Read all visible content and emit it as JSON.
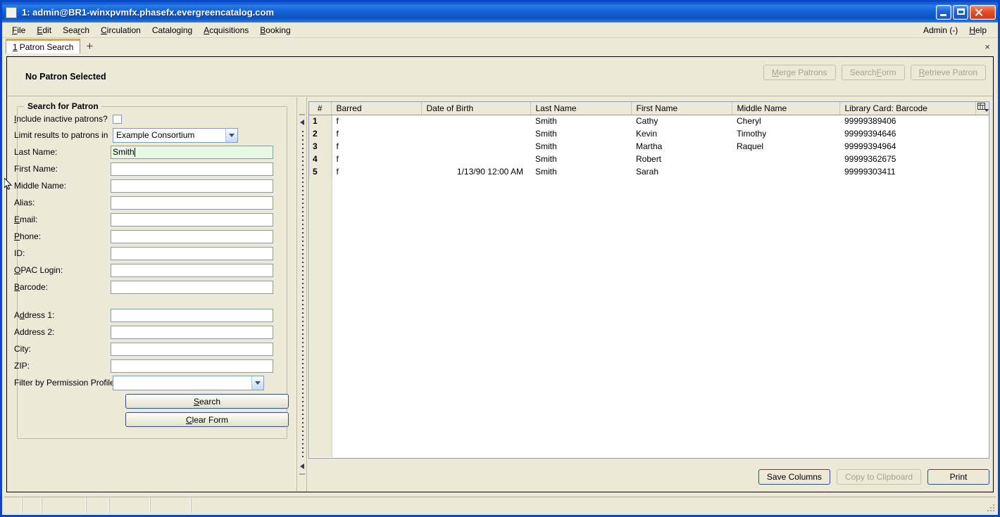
{
  "window": {
    "title": "1: admin@BR1-winxpvmfx.phasefx.evergreencatalog.com",
    "icon": "app-window-icon",
    "minimize_label": "Minimize",
    "maximize_label": "Maximize",
    "close_label": "Close"
  },
  "menubar": {
    "items": [
      {
        "label": "File",
        "accel": "F"
      },
      {
        "label": "Edit",
        "accel": "E"
      },
      {
        "label": "Search",
        "accel": "r"
      },
      {
        "label": "Circulation",
        "accel": "C"
      },
      {
        "label": "Cataloging",
        "accel": "g"
      },
      {
        "label": "Acquisitions",
        "accel": "A"
      },
      {
        "label": "Booking",
        "accel": "B"
      }
    ],
    "right": [
      {
        "label": "Admin (-)",
        "accel": ""
      },
      {
        "label": "Help",
        "accel": "H"
      }
    ]
  },
  "tabs": {
    "items": [
      {
        "number": "1",
        "label": "Patron Search"
      }
    ],
    "new_tab_label": "+",
    "close_label": "×"
  },
  "patron_header": {
    "status": "No Patron Selected",
    "buttons": [
      {
        "label": "Merge Patrons",
        "accel": "M",
        "disabled": true
      },
      {
        "label": "Search Form",
        "accel": "F",
        "disabled": true
      },
      {
        "label": "Retrieve Patron",
        "accel": "R",
        "disabled": true
      }
    ]
  },
  "search_form": {
    "legend": "Search for Patron",
    "include_inactive": {
      "label": "Include inactive patrons?",
      "accel": "I",
      "checked": false
    },
    "limit_results": {
      "label": "Limit results to patrons in",
      "value": "Example Consortium"
    },
    "fields": [
      {
        "label": "Last Name:",
        "accel": "",
        "value": "Smith",
        "focused": true
      },
      {
        "label": "First Name:",
        "accel": "",
        "value": ""
      },
      {
        "label": "Middle Name:",
        "accel": "",
        "value": ""
      },
      {
        "label": "Alias:",
        "accel": "",
        "value": ""
      },
      {
        "label": "Email:",
        "accel": "E",
        "value": ""
      },
      {
        "label": "Phone:",
        "accel": "P",
        "value": ""
      },
      {
        "label": "ID:",
        "accel": "",
        "value": ""
      },
      {
        "label": "OPAC Login:",
        "accel": "O",
        "value": ""
      },
      {
        "label": "Barcode:",
        "accel": "B",
        "value": ""
      }
    ],
    "address_fields": [
      {
        "label": "Address 1:",
        "accel": "d",
        "value": ""
      },
      {
        "label": "Address 2:",
        "accel": "",
        "value": ""
      },
      {
        "label": "City:",
        "accel": "",
        "value": ""
      },
      {
        "label": "ZIP:",
        "accel": "",
        "value": ""
      }
    ],
    "permission_profile": {
      "label": "Filter by Permission Profile:",
      "value": ""
    },
    "search_button": {
      "label": "Search",
      "accel": "S"
    },
    "clear_button": {
      "label": "Clear Form",
      "accel": "C"
    }
  },
  "results": {
    "columns": [
      "#",
      "Barred",
      "Date of Birth",
      "Last Name",
      "First Name",
      "Middle Name",
      "Library Card: Barcode"
    ],
    "column_picker_icon": "column-picker-icon",
    "rows": [
      {
        "num": "1",
        "barred": "f",
        "dob": "",
        "last": "Smith",
        "first": "Cathy",
        "middle": "Cheryl",
        "barcode": "99999389406"
      },
      {
        "num": "2",
        "barred": "f",
        "dob": "",
        "last": "Smith",
        "first": "Kevin",
        "middle": "Timothy",
        "barcode": "99999394646"
      },
      {
        "num": "3",
        "barred": "f",
        "dob": "",
        "last": "Smith",
        "first": "Martha",
        "middle": "Raquel",
        "barcode": "99999394964"
      },
      {
        "num": "4",
        "barred": "f",
        "dob": "",
        "last": "Smith",
        "first": "Robert",
        "middle": "",
        "barcode": "99999362675"
      },
      {
        "num": "5",
        "barred": "f",
        "dob": "1/13/90 12:00 AM",
        "last": "Smith",
        "first": "Sarah",
        "middle": "",
        "barcode": "99999303411"
      }
    ],
    "buttons": [
      {
        "label": "Save Columns",
        "disabled": false
      },
      {
        "label": "Copy to Clipboard",
        "disabled": true
      },
      {
        "label": "Print",
        "disabled": false
      }
    ]
  },
  "colors": {
    "window_chrome": "#0a46c8",
    "face": "#ece9d8",
    "field_border": "#7f9db9",
    "filled_field": "#e6f7e3",
    "tab_accent": "#f0a224",
    "grid_border": "#8ca0b8"
  }
}
